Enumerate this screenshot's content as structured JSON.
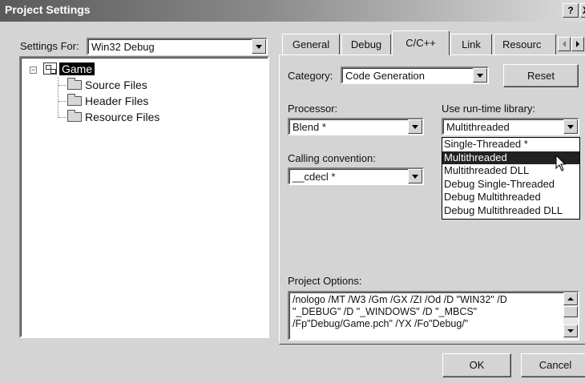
{
  "window": {
    "title": "Project Settings",
    "help_button": "?",
    "close_button": "X"
  },
  "left": {
    "settings_for_label": "Settings For:",
    "settings_for_value": "Win32 Debug",
    "tree": {
      "root": "Game",
      "children": [
        "Source Files",
        "Header Files",
        "Resource Files"
      ]
    }
  },
  "tabs": [
    {
      "label": "General"
    },
    {
      "label": "Debug"
    },
    {
      "label": "C/C++"
    },
    {
      "label": "Link"
    },
    {
      "label": "Resourc"
    }
  ],
  "active_tab": "C/C++",
  "cpp": {
    "category_label": "Category:",
    "category_value": "Code Generation",
    "reset_button": "Reset",
    "processor_label": "Processor:",
    "processor_value": "Blend *",
    "runtime_label": "Use run-time library:",
    "runtime_value": "Multithreaded",
    "runtime_options": [
      "Single-Threaded *",
      "Multithreaded",
      "Multithreaded DLL",
      "Debug Single-Threaded",
      "Debug Multithreaded",
      "Debug Multithreaded DLL"
    ],
    "runtime_selected_index": 1,
    "calling_label": "Calling convention:",
    "calling_value": "__cdecl *",
    "project_options_label": "Project Options:",
    "project_options_lines": [
      "/nologo /MT /W3 /Gm /GX /ZI /Od /D \"WIN32\" /D",
      "\"_DEBUG\" /D \"_WINDOWS\" /D \"_MBCS\"",
      "/Fp\"Debug/Game.pch\" /YX /Fo\"Debug/\""
    ]
  },
  "footer": {
    "ok_button": "OK",
    "cancel_button": "Cancel"
  }
}
